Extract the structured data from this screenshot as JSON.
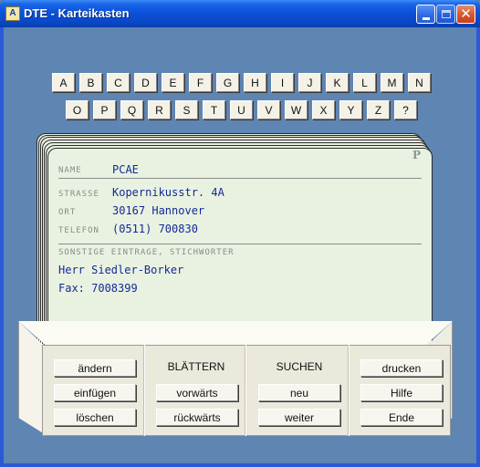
{
  "window": {
    "title": "DTE - Karteikasten",
    "icon": "app-card-icon",
    "icon_glyph": "A"
  },
  "index": {
    "row1": [
      "A",
      "B",
      "C",
      "D",
      "E",
      "F",
      "G",
      "H",
      "I",
      "J",
      "K",
      "L",
      "M",
      "N"
    ],
    "row2": [
      "O",
      "P",
      "Q",
      "R",
      "S",
      "T",
      "U",
      "V",
      "W",
      "X",
      "Y",
      "Z",
      "?"
    ]
  },
  "card": {
    "letter": "P",
    "name_label": "NAME",
    "name": "PCAE",
    "street_label": "STRASSE",
    "street": "Kopernikusstr. 4A",
    "city_label": "ORT",
    "city": "30167 Hannover",
    "phone_label": "TELEFON",
    "phone": "(0511) 700830",
    "misc_label": "SONSTIGE EINTRAGE, STICHWORTER",
    "misc_lines": [
      "Herr Siedler-Borker",
      "Fax: 7008399"
    ]
  },
  "drawer": {
    "edit": {
      "change": "ändern",
      "insert": "einfügen",
      "delete": "löschen"
    },
    "browse": {
      "title": "BLÄTTERN",
      "forward": "vorwärts",
      "back": "rückwärts"
    },
    "search": {
      "title": "SUCHEN",
      "new": "neu",
      "next": "weiter"
    },
    "misc": {
      "print": "drucken",
      "help": "Hilfe",
      "end": "Ende"
    }
  },
  "colors": {
    "background": "#5f85b2",
    "card": "#e9f2e1",
    "value_text": "#142a96",
    "titlebar": "#0a50d8"
  }
}
